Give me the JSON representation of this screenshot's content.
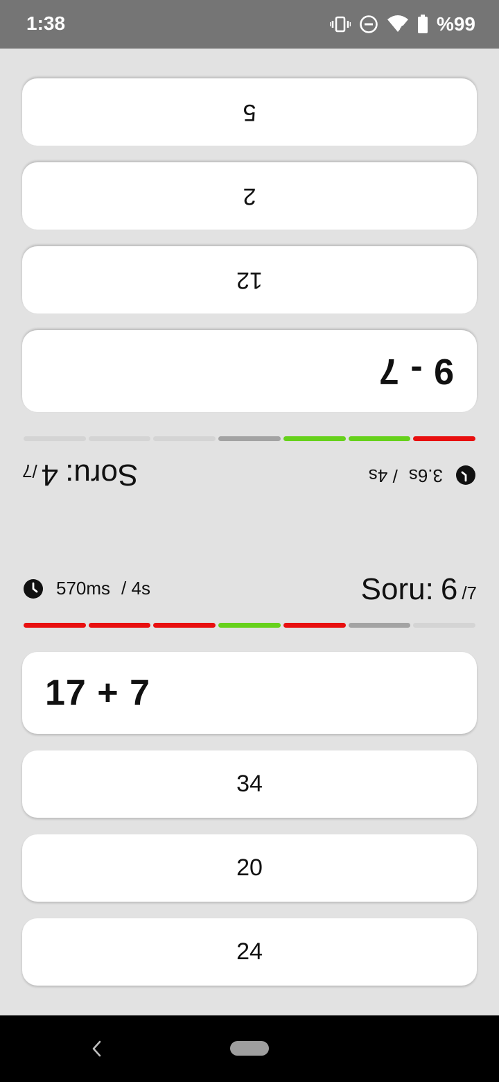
{
  "status_bar": {
    "time": "1:38",
    "battery": "%99",
    "icons": [
      "vibrate-icon",
      "dnd-icon",
      "wifi-icon",
      "battery-icon"
    ]
  },
  "colors": {
    "correct": "#66d11b",
    "wrong": "#e80f0f",
    "current": "#a3a3a3",
    "pending": "#d4d4d4"
  },
  "player_top": {
    "timer_elapsed": "3.6s",
    "timer_limit": "/ 4s",
    "question_label": "Soru:",
    "question_number": "4",
    "question_total": "/7",
    "progress": [
      "wrong",
      "correct",
      "correct",
      "current",
      "pending",
      "pending",
      "pending"
    ],
    "problem": "9 - 7",
    "answers": [
      "12",
      "2",
      "5"
    ]
  },
  "player_bottom": {
    "timer_elapsed": "570ms",
    "timer_limit": "/ 4s",
    "question_label": "Soru:",
    "question_number": "6",
    "question_total": "/7",
    "progress": [
      "wrong",
      "wrong",
      "wrong",
      "correct",
      "wrong",
      "current",
      "pending"
    ],
    "problem": "17 + 7",
    "answers": [
      "34",
      "20",
      "24"
    ]
  }
}
